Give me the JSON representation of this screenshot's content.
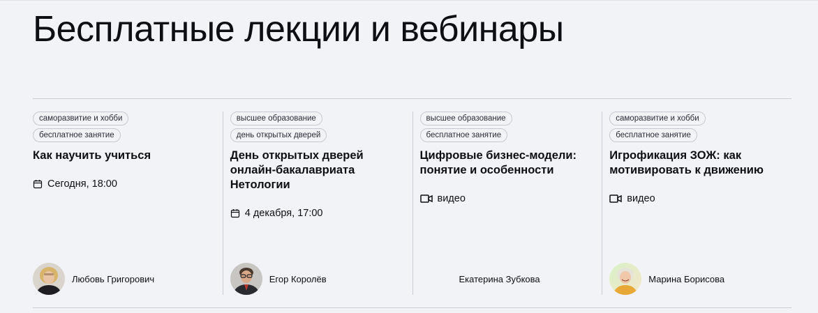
{
  "page": {
    "title": "Бесплатные лекции и вебинары"
  },
  "cards": [
    {
      "tags": [
        "саморазвитие и хобби",
        "бесплатное занятие"
      ],
      "title": "Как научить учиться",
      "meta_type": "calendar-icon",
      "meta_text": "Сегодня, 18:00",
      "author": "Любовь Григорович",
      "avatar": "avatar-woman-blonde"
    },
    {
      "tags": [
        "высшее образование",
        "день открытых дверей"
      ],
      "title": "День открытых дверей онлайн-бакалавриата Нетологии",
      "meta_type": "calendar-icon",
      "meta_text": "4 декабря, 17:00",
      "author": "Егор Королёв",
      "avatar": "avatar-man-glasses"
    },
    {
      "tags": [
        "высшее образование",
        "бесплатное занятие"
      ],
      "title": "Цифровые бизнес-модели: понятие и особенности",
      "meta_type": "video-camera-icon",
      "meta_text": "видео",
      "author": "Екатерина Зубкова",
      "avatar": "none"
    },
    {
      "tags": [
        "саморазвитие и хобби",
        "бесплатное занятие"
      ],
      "title": "Игрофикация ЗОЖ: как мотивировать к движению",
      "meta_type": "video-camera-icon",
      "meta_text": "видео",
      "author": "Марина Борисова",
      "avatar": "avatar-woman-smiling"
    }
  ]
}
